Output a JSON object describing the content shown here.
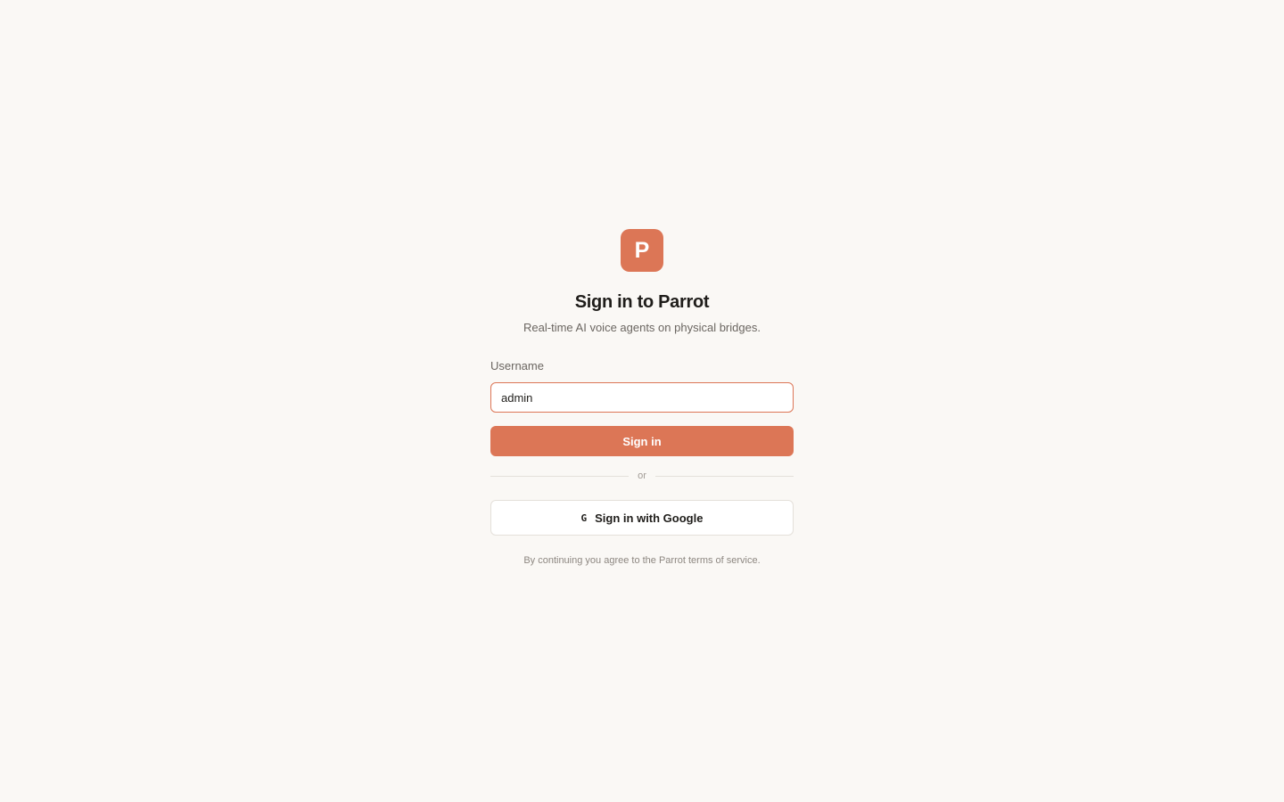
{
  "brand": {
    "logo_letter": "P",
    "accent_color": "#dc7656"
  },
  "header": {
    "title": "Sign in to Parrot",
    "subtitle": "Real-time AI voice agents on physical bridges."
  },
  "form": {
    "username_label": "Username",
    "username_value": "admin",
    "submit_label": "Sign in"
  },
  "divider": {
    "text": "or"
  },
  "google": {
    "icon_glyph": "G",
    "label": "Sign in with Google"
  },
  "footer": {
    "terms_text": "By continuing you agree to the Parrot terms of service."
  }
}
